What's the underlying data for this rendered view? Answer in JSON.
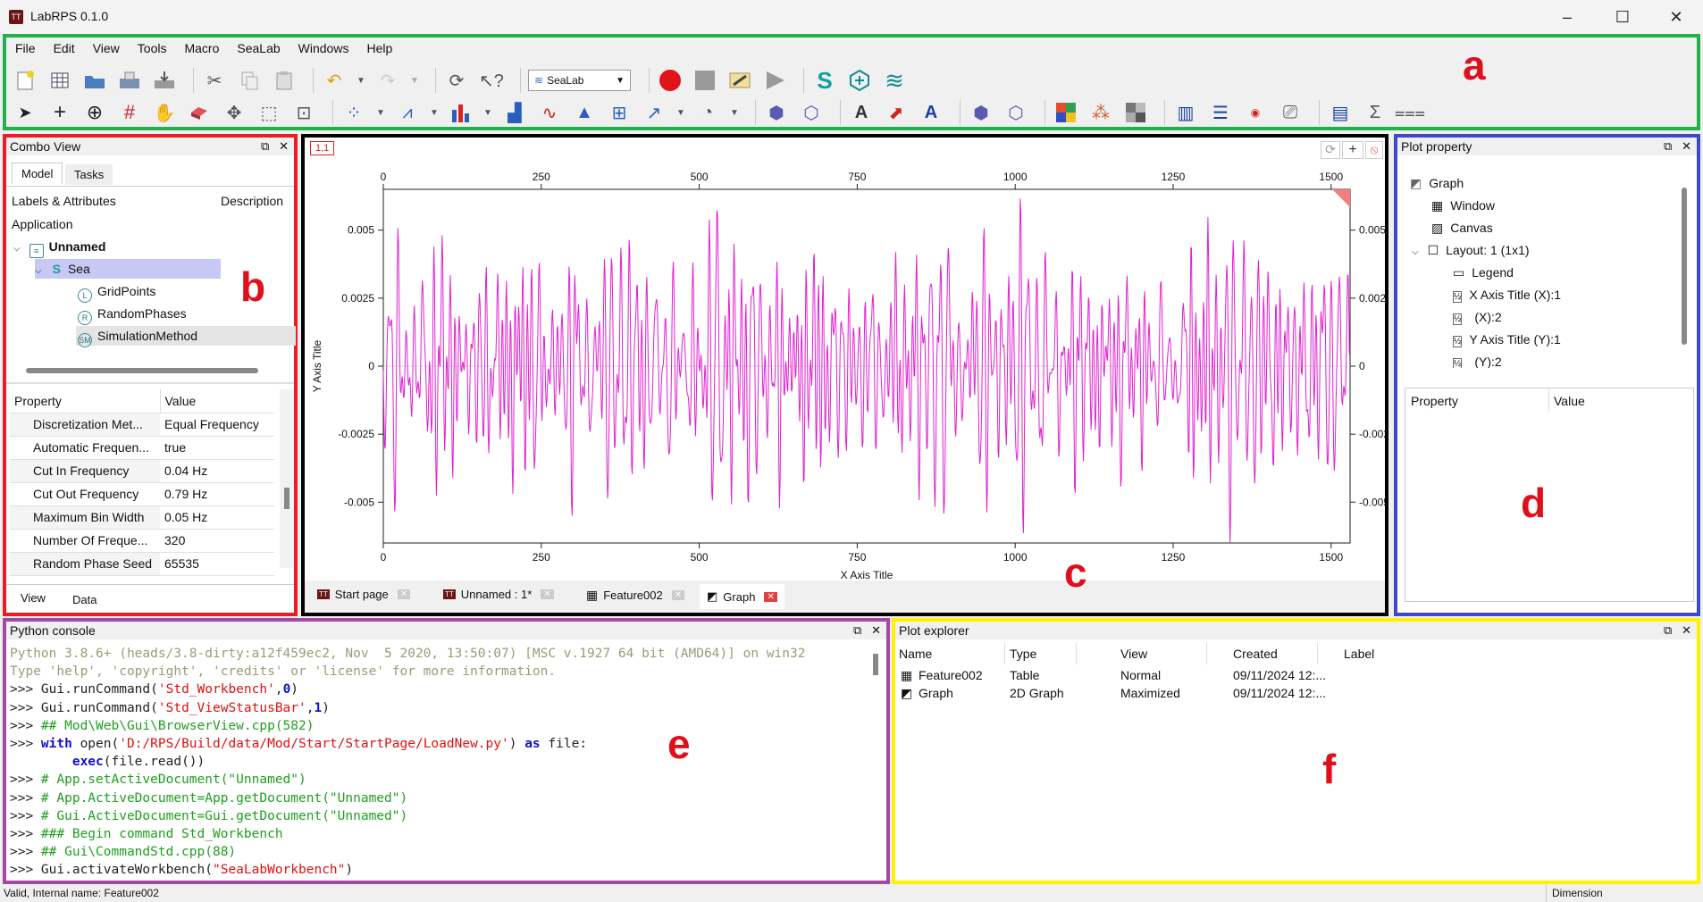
{
  "window": {
    "title": "LabRPS 0.1.0",
    "logo": "TT",
    "minimize": "–",
    "maximize": "☐",
    "close": "✕"
  },
  "menu": [
    "File",
    "Edit",
    "View",
    "Tools",
    "Macro",
    "SeaLab",
    "Windows",
    "Help"
  ],
  "toolbar": {
    "workbench_combo": "SeaLab"
  },
  "region_labels": {
    "a": "a",
    "b": "b",
    "c": "c",
    "d": "d",
    "e": "e",
    "f": "f"
  },
  "combo_view": {
    "title": "Combo View",
    "tabs": [
      "Model",
      "Tasks"
    ],
    "tree_headers": {
      "col1": "Labels & Attributes",
      "col2": "Description"
    },
    "tree": [
      {
        "label": "Application",
        "level": 0
      },
      {
        "label": "Unnamed",
        "level": 1
      },
      {
        "label": "Sea",
        "level": 2
      },
      {
        "label": "GridPoints",
        "level": 3
      },
      {
        "label": "RandomPhases",
        "level": 3
      },
      {
        "label": "SimulationMethod",
        "level": 3
      }
    ],
    "property_headers": {
      "col1": "Property",
      "col2": "Value"
    },
    "properties": [
      {
        "name": "Discretization Met...",
        "value": "Equal Frequency"
      },
      {
        "name": "Automatic Frequen...",
        "value": "true"
      },
      {
        "name": "Cut In Frequency",
        "value": "0.04 Hz"
      },
      {
        "name": "Cut Out Frequency",
        "value": "0.79 Hz"
      },
      {
        "name": "Maximum Bin Width",
        "value": "0.05 Hz"
      },
      {
        "name": "Number Of Freque...",
        "value": "320"
      },
      {
        "name": "Random Phase Seed",
        "value": "65535"
      }
    ],
    "bottom_tabs": [
      "View",
      "Data"
    ]
  },
  "graph": {
    "layer_label": "1,1",
    "doc_tabs": [
      "Start page",
      "Unnamed : 1*",
      "Feature002",
      "Graph"
    ]
  },
  "chart_data": {
    "type": "line",
    "title": "",
    "xlabel": "X Axis Title",
    "ylabel": "Y Axis Title",
    "xlim": [
      0,
      1530
    ],
    "ylim": [
      -0.0065,
      0.0065
    ],
    "x_ticks": [
      0,
      250,
      500,
      750,
      1000,
      1250,
      1500
    ],
    "y_ticks": [
      -0.005,
      -0.0025,
      0,
      0.0025,
      0.005
    ],
    "y_tick_labels": [
      "-0.005",
      "-0.0025",
      "0",
      "0.0025",
      "0.005"
    ],
    "series": [
      {
        "color": "#e020d0",
        "n_points": 1530,
        "amplitude_hint": 0.0065
      }
    ],
    "grid": false
  },
  "plot_property": {
    "title": "Plot property",
    "tree": [
      {
        "label": "Graph",
        "level": 0
      },
      {
        "label": "Window",
        "level": 1
      },
      {
        "label": "Canvas",
        "level": 1
      },
      {
        "label": "Layout: 1 (1x1)",
        "level": 1
      },
      {
        "label": "Legend",
        "level": 2
      },
      {
        "label": "X Axis Title (X):1",
        "level": 2
      },
      {
        "label": "(X):2",
        "level": 2
      },
      {
        "label": "Y Axis Title (Y):1",
        "level": 2
      },
      {
        "label": "(Y):2",
        "level": 2
      }
    ],
    "property_headers": {
      "col1": "Property",
      "col2": "Value"
    }
  },
  "python_console": {
    "title": "Python console",
    "lines": [
      {
        "prompt": "",
        "parts": [
          {
            "t": "Python 3.8.6+ (heads/3.8-dirty:a12f459ec2, Nov  5 2020, 13:50:07) [MSC v.1927 64 bit (AMD64)] on win32",
            "c": "gray"
          }
        ]
      },
      {
        "prompt": "",
        "parts": [
          {
            "t": "Type 'help', 'copyright', 'credits' or 'license' for more information.",
            "c": "gray"
          }
        ]
      },
      {
        "prompt": ">>> ",
        "parts": [
          {
            "t": "Gui.runCommand(",
            "c": "dark"
          },
          {
            "t": "'Std_Workbench'",
            "c": "red"
          },
          {
            "t": ",",
            "c": "dark"
          },
          {
            "t": "0",
            "c": "blue"
          },
          {
            "t": ")",
            "c": "dark"
          }
        ]
      },
      {
        "prompt": ">>> ",
        "parts": [
          {
            "t": "Gui.runCommand(",
            "c": "dark"
          },
          {
            "t": "'Std_ViewStatusBar'",
            "c": "red"
          },
          {
            "t": ",",
            "c": "dark"
          },
          {
            "t": "1",
            "c": "blue"
          },
          {
            "t": ")",
            "c": "dark"
          }
        ]
      },
      {
        "prompt": ">>> ",
        "parts": [
          {
            "t": "## Mod\\Web\\Gui\\BrowserView.cpp(582)",
            "c": "green"
          }
        ]
      },
      {
        "prompt": ">>> ",
        "parts": [
          {
            "t": "with",
            "c": "blue"
          },
          {
            "t": " open(",
            "c": "dark"
          },
          {
            "t": "'D:/RPS/Build/data/Mod/Start/StartPage/LoadNew.py'",
            "c": "red"
          },
          {
            "t": ") ",
            "c": "dark"
          },
          {
            "t": "as",
            "c": "blue"
          },
          {
            "t": " file:",
            "c": "dark"
          }
        ]
      },
      {
        "prompt": "        ",
        "parts": [
          {
            "t": "exec",
            "c": "blue"
          },
          {
            "t": "(file.read())",
            "c": "dark"
          }
        ]
      },
      {
        "prompt": ">>> ",
        "parts": [
          {
            "t": "# App.setActiveDocument(\"Unnamed\")",
            "c": "green"
          }
        ]
      },
      {
        "prompt": ">>> ",
        "parts": [
          {
            "t": "# App.ActiveDocument=App.getDocument(\"Unnamed\")",
            "c": "green"
          }
        ]
      },
      {
        "prompt": ">>> ",
        "parts": [
          {
            "t": "# Gui.ActiveDocument=Gui.getDocument(\"Unnamed\")",
            "c": "green"
          }
        ]
      },
      {
        "prompt": ">>> ",
        "parts": [
          {
            "t": "### Begin command Std_Workbench",
            "c": "green"
          }
        ]
      },
      {
        "prompt": ">>> ",
        "parts": [
          {
            "t": "## Gui\\CommandStd.cpp(88)",
            "c": "green"
          }
        ]
      },
      {
        "prompt": ">>> ",
        "parts": [
          {
            "t": "Gui.activateWorkbench(",
            "c": "dark"
          },
          {
            "t": "\"SeaLabWorkbench\"",
            "c": "red"
          },
          {
            "t": ")",
            "c": "dark"
          }
        ]
      }
    ]
  },
  "plot_explorer": {
    "title": "Plot explorer",
    "headers": [
      "Name",
      "Type",
      "View",
      "Created",
      "Label"
    ],
    "rows": [
      {
        "name": "Feature002",
        "type": "Table",
        "view": "Normal",
        "created": "09/11/2024 12:...",
        "label": ""
      },
      {
        "name": "Graph",
        "type": "2D Graph",
        "view": "Maximized",
        "created": "09/11/2024 12:...",
        "label": ""
      }
    ]
  },
  "statusbar": {
    "left": "Valid, Internal name: Feature002",
    "right": "Dimension"
  }
}
